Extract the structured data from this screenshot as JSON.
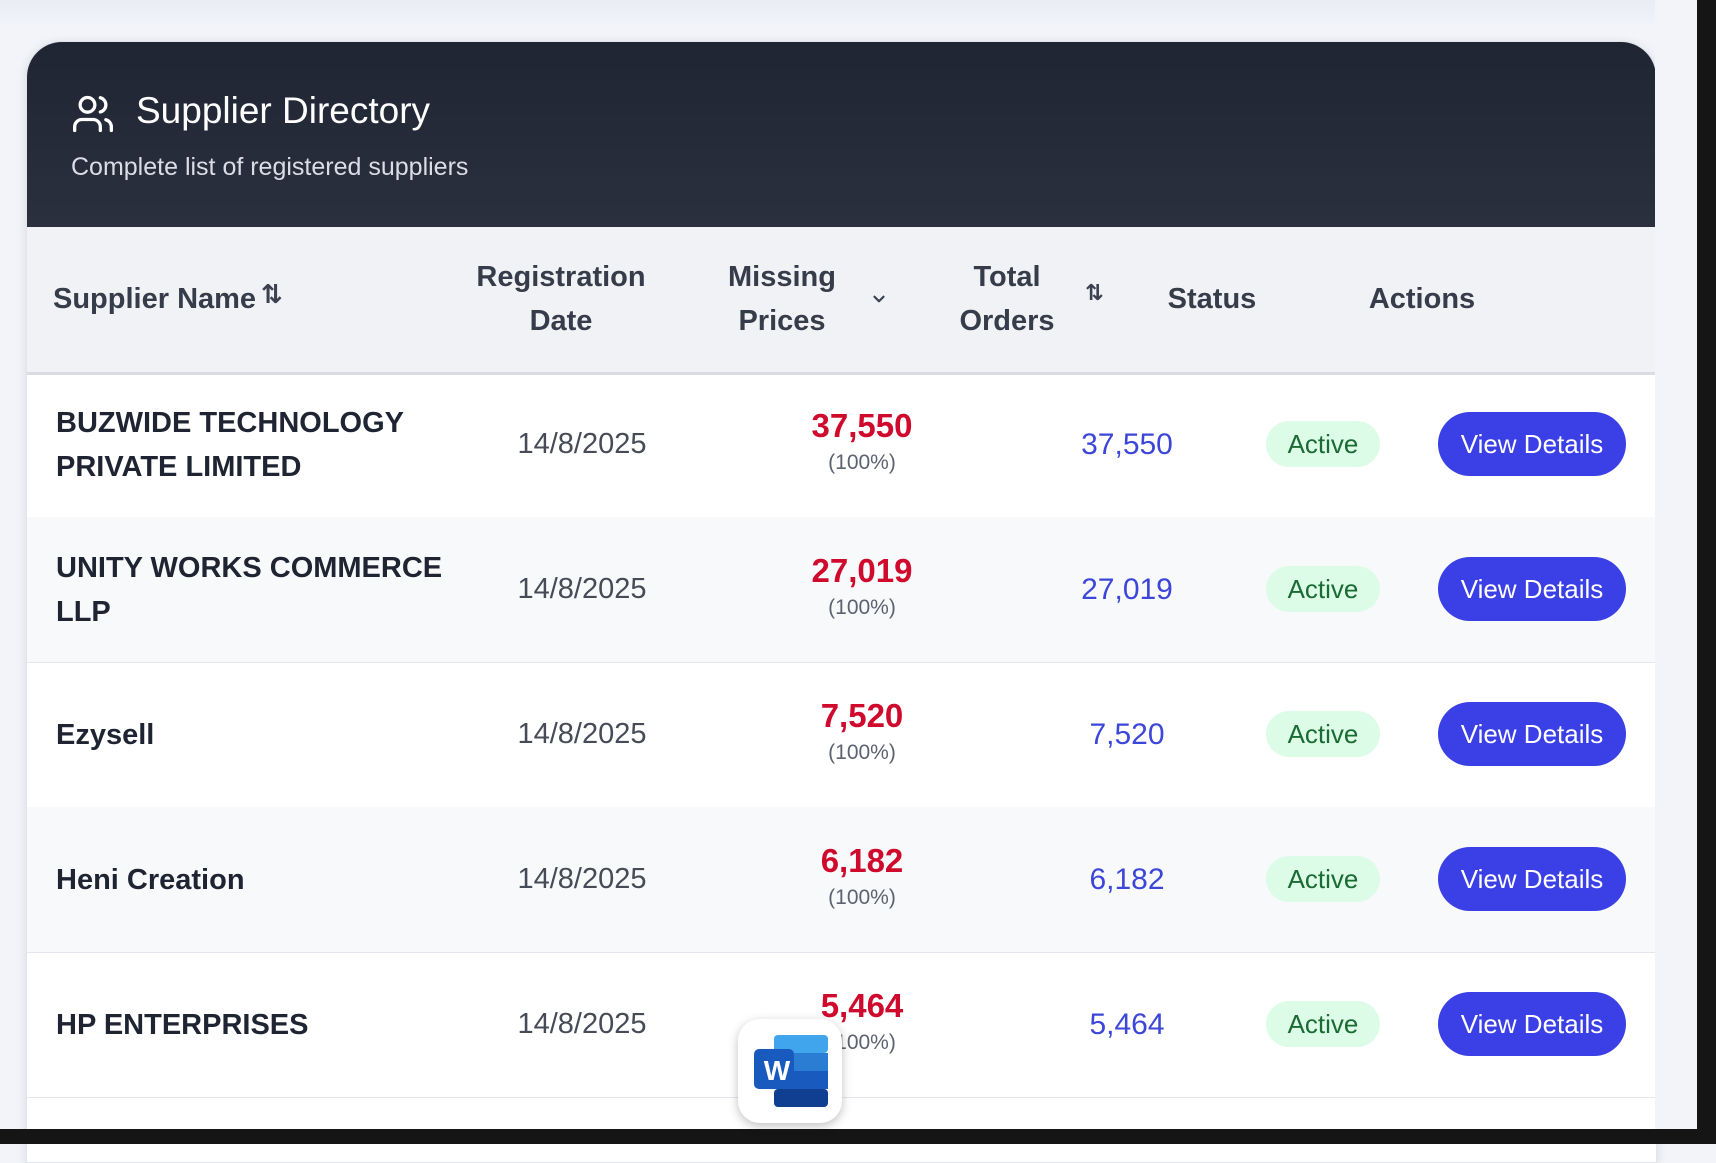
{
  "header": {
    "title": "Supplier Directory",
    "subtitle": "Complete list of registered suppliers"
  },
  "columns": {
    "name": "Supplier Name",
    "reg_line1": "Registration",
    "reg_line2": "Date",
    "missing_line1": "Missing",
    "missing_line2": "Prices",
    "orders_line1": "Total",
    "orders_line2": "Orders",
    "status": "Status",
    "actions": "Actions"
  },
  "rows": [
    {
      "name_line1": "BUZWIDE TECHNOLOGY",
      "name_line2": "PRIVATE LIMITED",
      "date": "14/8/2025",
      "missing": "37,550",
      "missing_pct": "(100%)",
      "orders": "37,550",
      "status": "Active",
      "action": "View Details"
    },
    {
      "name_line1": "UNITY WORKS COMMERCE",
      "name_line2": "LLP",
      "date": "14/8/2025",
      "missing": "27,019",
      "missing_pct": "(100%)",
      "orders": "27,019",
      "status": "Active",
      "action": "View Details"
    },
    {
      "name_line1": "Ezysell",
      "name_line2": "",
      "date": "14/8/2025",
      "missing": "7,520",
      "missing_pct": "(100%)",
      "orders": "7,520",
      "status": "Active",
      "action": "View Details"
    },
    {
      "name_line1": "Heni Creation",
      "name_line2": "",
      "date": "14/8/2025",
      "missing": "6,182",
      "missing_pct": "(100%)",
      "orders": "6,182",
      "status": "Active",
      "action": "View Details"
    },
    {
      "name_line1": "HP ENTERPRISES",
      "name_line2": "",
      "date": "14/8/2025",
      "missing": "5,464",
      "missing_pct": "(100%)",
      "orders": "5,464",
      "status": "Active",
      "action": "View Details"
    }
  ],
  "colors": {
    "header_bg": "#1f2532",
    "missing_red": "#cf0a2c",
    "orders_blue": "#3c46d8",
    "button_blue": "#3b3fe6",
    "badge_green_bg": "#dcfce7",
    "badge_green_text": "#1b6b34"
  },
  "icons": {
    "header": "users-icon",
    "sort": "sort-arrows-icon",
    "dropdown": "chevron-down-icon",
    "dock_app": "word-app-icon"
  },
  "dock": {
    "app_letter": "W"
  }
}
